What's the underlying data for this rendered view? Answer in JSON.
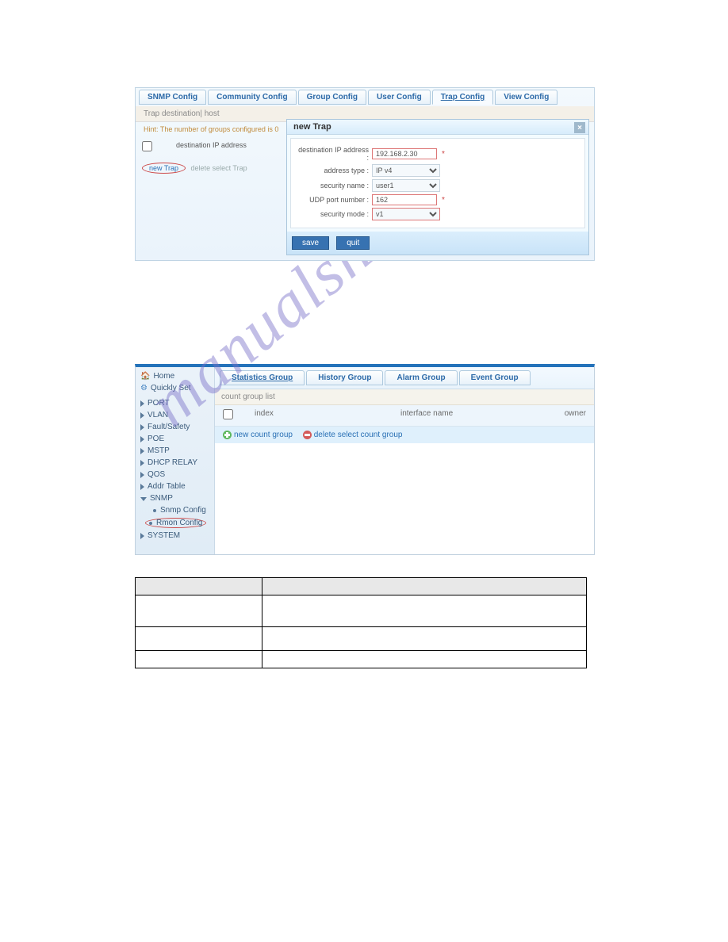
{
  "watermark": "manualshive.com",
  "shot1": {
    "tabs": [
      "SNMP Config",
      "Community Config",
      "Group Config",
      "User Config",
      "Trap Config",
      "View Config"
    ],
    "active_tab_index": 4,
    "subheader": "Trap destination| host",
    "hint": "Hint: The number of groups configured is 0",
    "left": {
      "col_header": "destination IP address",
      "new_link": "new Trap",
      "delete_link": "delete select Trap"
    },
    "modal": {
      "title": "new Trap",
      "close": "×",
      "fields": {
        "dest_label": "destination IP address :",
        "dest_value": "192.168.2.30",
        "addrtype_label": "address type :",
        "addrtype_value": "IP v4",
        "secname_label": "security name :",
        "secname_value": "user1",
        "udp_label": "UDP port number :",
        "udp_value": "162",
        "secmode_label": "security mode :",
        "secmode_value": "v1"
      },
      "save": "save",
      "quit": "quit"
    }
  },
  "shot2": {
    "sidebar_top": [
      {
        "label": "Home",
        "icon": "home"
      },
      {
        "label": "Quickly Set",
        "icon": "quick"
      }
    ],
    "sidebar": [
      "PORT",
      "VLAN",
      "Fault/Safety",
      "POE",
      "MSTP",
      "DHCP RELAY",
      "QOS",
      "Addr Table"
    ],
    "snmp": {
      "label": "SNMP",
      "children": [
        "Snmp Config",
        "Rmon Config"
      ]
    },
    "system": "SYSTEM",
    "tabs": [
      "Statistics Group",
      "History Group",
      "Alarm Group",
      "Event Group"
    ],
    "active_tab_index": 0,
    "list_header": "count group list",
    "columns": [
      "",
      "index",
      "interface name",
      "owner"
    ],
    "actions": {
      "new": "new count group",
      "del": "delete select count group"
    }
  }
}
